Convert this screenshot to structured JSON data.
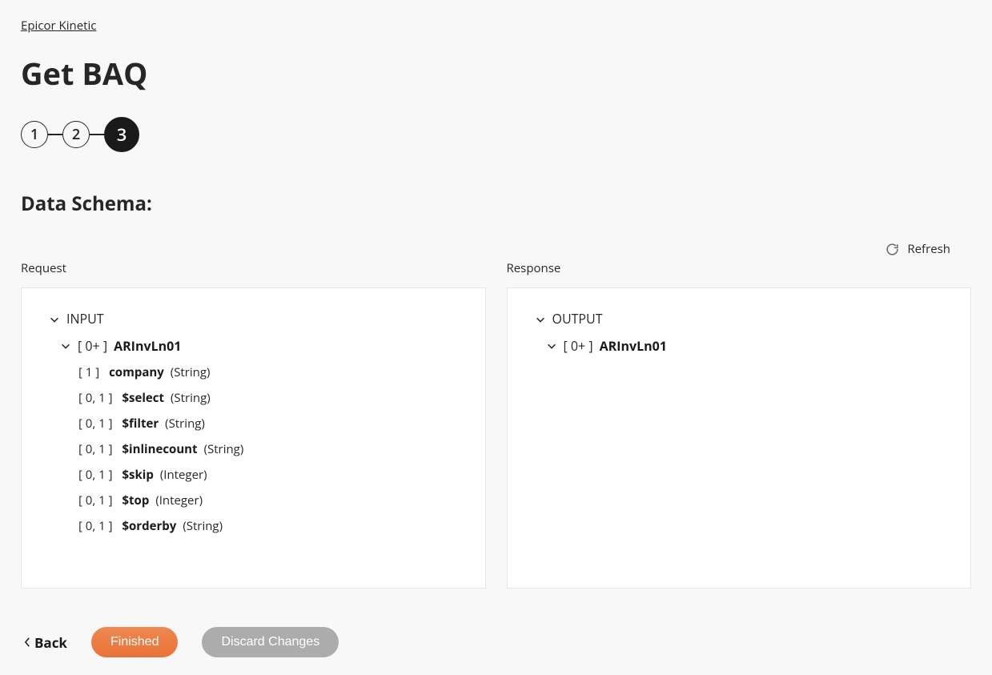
{
  "breadcrumb": "Epicor Kinetic",
  "title": "Get BAQ",
  "steps": [
    "1",
    "2",
    "3"
  ],
  "activeStep": 2,
  "sectionTitle": "Data Schema:",
  "refreshLabel": "Refresh",
  "columns": {
    "request": "Request",
    "response": "Response"
  },
  "request": {
    "root": "INPUT",
    "group": {
      "card": "[ 0+ ]",
      "name": "ARInvLn01"
    },
    "fields": [
      {
        "card": "[ 1 ]",
        "name": "company",
        "type": "(String)"
      },
      {
        "card": "[ 0, 1 ]",
        "name": "$select",
        "type": "(String)"
      },
      {
        "card": "[ 0, 1 ]",
        "name": "$filter",
        "type": "(String)"
      },
      {
        "card": "[ 0, 1 ]",
        "name": "$inlinecount",
        "type": "(String)"
      },
      {
        "card": "[ 0, 1 ]",
        "name": "$skip",
        "type": "(Integer)"
      },
      {
        "card": "[ 0, 1 ]",
        "name": "$top",
        "type": "(Integer)"
      },
      {
        "card": "[ 0, 1 ]",
        "name": "$orderby",
        "type": "(String)"
      }
    ]
  },
  "response": {
    "root": "OUTPUT",
    "group": {
      "card": "[ 0+ ]",
      "name": "ARInvLn01"
    }
  },
  "footer": {
    "back": "Back",
    "finished": "Finished",
    "discard": "Discard Changes"
  }
}
